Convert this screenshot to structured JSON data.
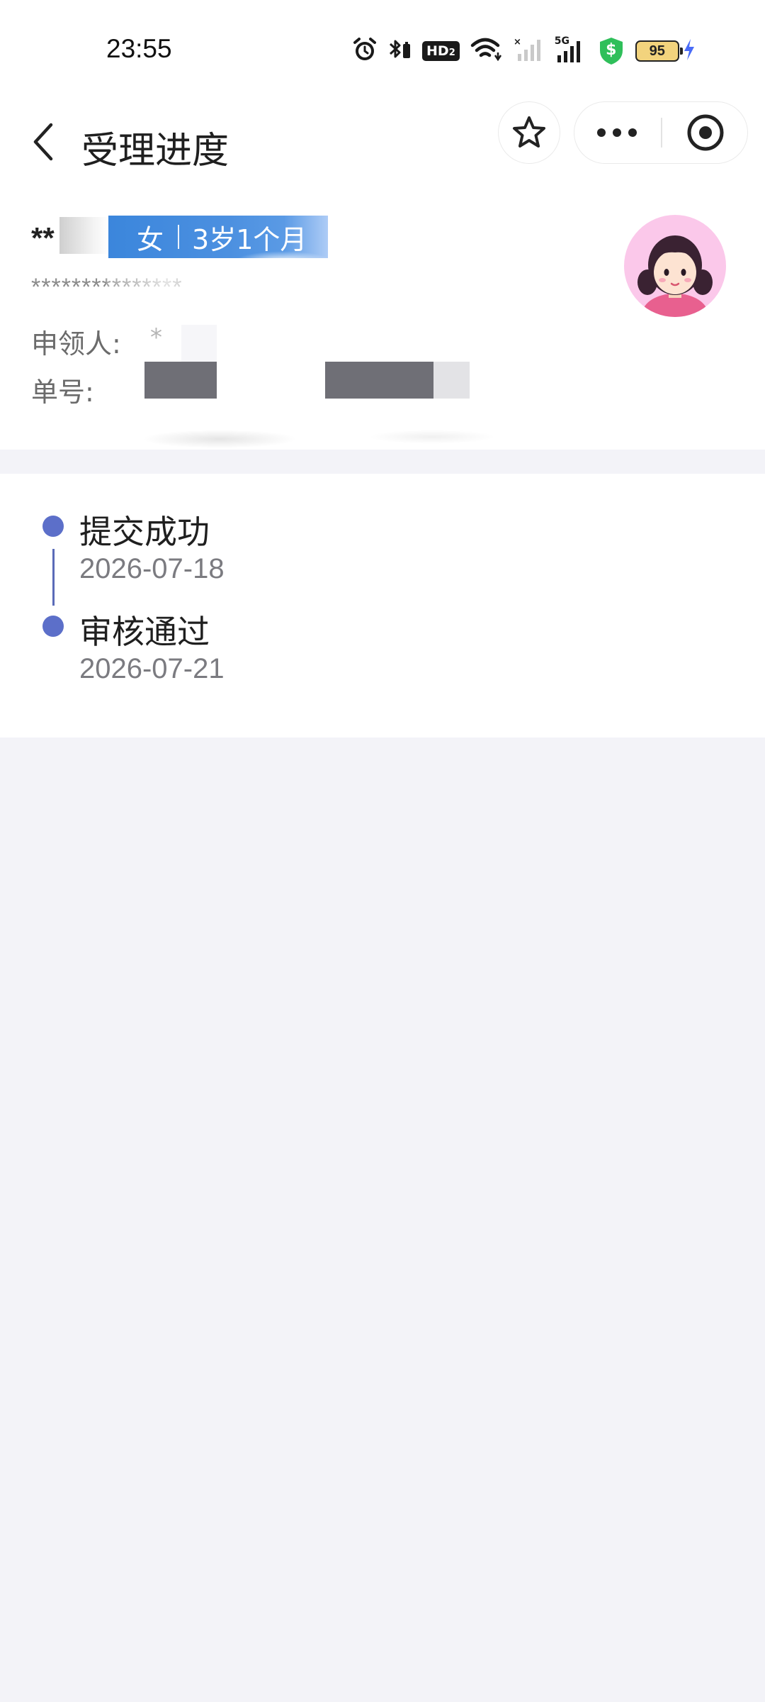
{
  "status_bar": {
    "time": "23:55",
    "icons": [
      "alarm-icon",
      "bluetooth-icon",
      "hd-icon",
      "wifi-icon",
      "signal-icon",
      "5g-signal-icon",
      "security-shield-icon",
      "battery-icon",
      "charging-icon"
    ],
    "hd_label": "HD",
    "network_label": "5G",
    "battery_level": "95",
    "shield_glyph": "$"
  },
  "nav": {
    "title": "受理进度",
    "back_icon": "chevron-left-icon",
    "favorite_icon": "star-icon",
    "more_icon": "more-dots-icon",
    "close_icon": "target-icon"
  },
  "profile": {
    "name": "**",
    "gender": "女",
    "age": "3岁1个月",
    "id_number": "***************",
    "applicant_label": "申领人:",
    "applicant_value": "*",
    "order_label": "单号:",
    "avatar_icon": "girl-avatar-icon"
  },
  "timeline": [
    {
      "title": "提交成功",
      "date": "2026-07-18"
    },
    {
      "title": "审核通过",
      "date": "2026-07-21"
    }
  ],
  "colors": {
    "accent": "#5c6fc9",
    "tag_blue": "#3b86dc",
    "page_bg": "#f3f3f8",
    "shield_green": "#2fbf5a",
    "battery_fill": "#f2d37d",
    "charging": "#4a6cf7"
  }
}
